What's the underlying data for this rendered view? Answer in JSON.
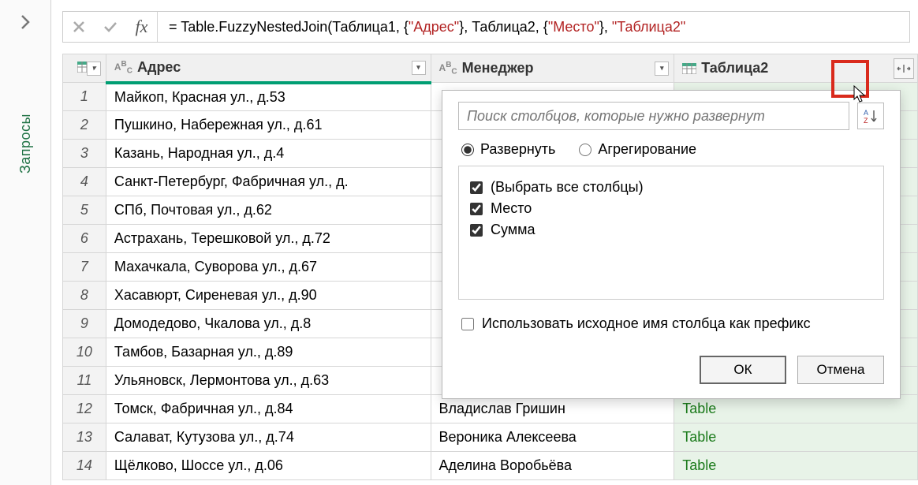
{
  "sidebar": {
    "label": "Запросы"
  },
  "formula": {
    "prefix": "= Table.FuzzyNestedJoin(Таблица1, {",
    "arg1": "\"Адрес\"",
    "mid1": "}, Таблица2, {",
    "arg2": "\"Место\"",
    "mid2": "}, ",
    "arg3": "\"Таблица2\""
  },
  "columns": {
    "adres": "Адрес",
    "mgr": "Менеджер",
    "tbl": "Таблица2"
  },
  "rows": [
    {
      "n": "1",
      "adres": "Майкоп, Красная ул., д.53",
      "mgr": "",
      "tbl": ""
    },
    {
      "n": "2",
      "adres": "Пушкино, Набережная ул., д.61",
      "mgr": "",
      "tbl": ""
    },
    {
      "n": "3",
      "adres": "Казань, Народная ул., д.4",
      "mgr": "",
      "tbl": ""
    },
    {
      "n": "4",
      "adres": "Санкт-Петербург, Фабричная ул., д.",
      "mgr": "",
      "tbl": ""
    },
    {
      "n": "5",
      "adres": "СПб, Почтовая ул., д.62",
      "mgr": "",
      "tbl": ""
    },
    {
      "n": "6",
      "adres": "Астрахань, Терешковой ул., д.72",
      "mgr": "",
      "tbl": ""
    },
    {
      "n": "7",
      "adres": "Махачкала, Суворова ул., д.67",
      "mgr": "",
      "tbl": ""
    },
    {
      "n": "8",
      "adres": "Хасавюрт, Сиреневая ул., д.90",
      "mgr": "",
      "tbl": ""
    },
    {
      "n": "9",
      "adres": "Домодедово, Чкалова ул., д.8",
      "mgr": "",
      "tbl": ""
    },
    {
      "n": "10",
      "adres": "Тамбов, Базарная ул., д.89",
      "mgr": "",
      "tbl": ""
    },
    {
      "n": "11",
      "adres": "Ульяновск, Лермонтова ул., д.63",
      "mgr": "",
      "tbl": ""
    },
    {
      "n": "12",
      "adres": "Томск, Фабричная ул., д.84",
      "mgr": "Владислав Гришин",
      "tbl": "Table"
    },
    {
      "n": "13",
      "adres": "Салават, Кутузова ул., д.74",
      "mgr": "Вероника Алексеева",
      "tbl": "Table"
    },
    {
      "n": "14",
      "adres": "Щёлково, Шоссе ул., д.06",
      "mgr": "Аделина Воробьёва",
      "tbl": "Table"
    }
  ],
  "popup": {
    "search_placeholder": "Поиск столбцов, которые нужно развернут",
    "expand_label": "Развернуть",
    "aggregate_label": "Агрегирование",
    "select_all": "(Выбрать все столбцы)",
    "col_mesto": "Место",
    "col_summa": "Сумма",
    "prefix_label": "Использовать исходное имя столбца как префикс",
    "ok": "ОК",
    "cancel": "Отмена"
  }
}
